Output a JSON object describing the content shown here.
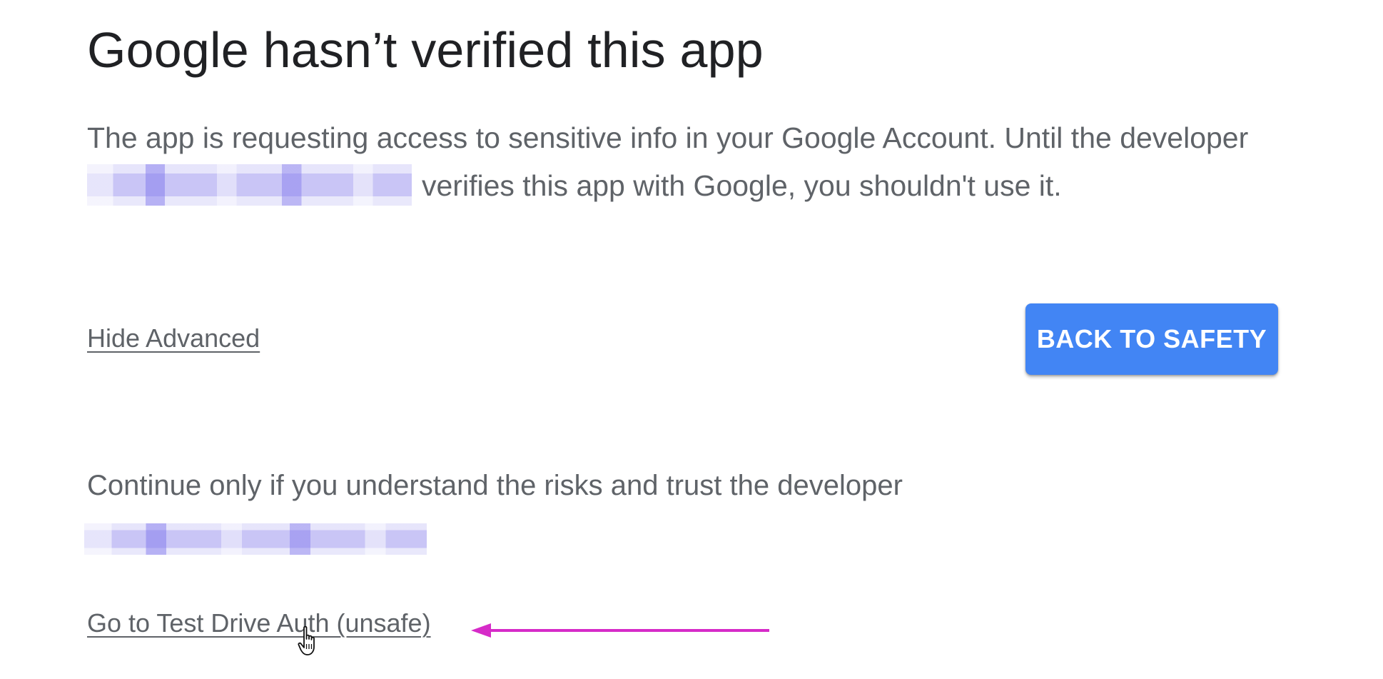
{
  "page": {
    "title": "Google hasn’t verified this app",
    "warning_text_before": "The app is requesting access to sensitive info in your Google Account. Until the developer",
    "warning_text_after": "verifies this app with Google, you shouldn't use it.",
    "hide_advanced_label": "Hide Advanced",
    "back_button_label": "BACK TO SAFETY",
    "continue_text": "Continue only if you understand the risks and trust the developer",
    "proceed_link_label": "Go to Test Drive Auth (unsafe)"
  },
  "colors": {
    "title": "#202124",
    "body_text": "#5f6368",
    "primary_button": "#4285f4",
    "annotation_arrow": "#d62bc8",
    "redaction": "#c9c5f6"
  },
  "icons": {
    "cursor": "hand-pointer-icon",
    "annotation": "arrow-left-icon"
  }
}
